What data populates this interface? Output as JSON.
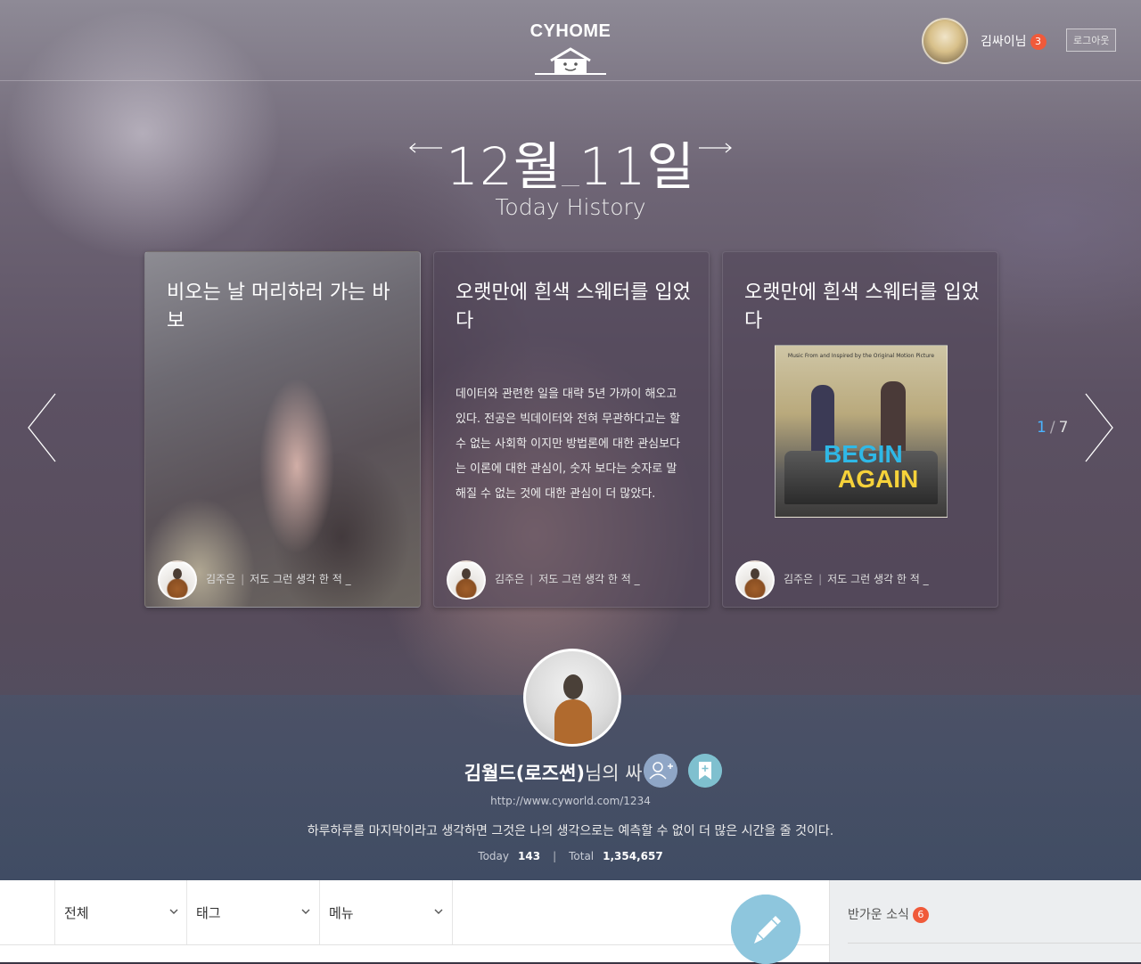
{
  "header": {
    "logo_text": "CYHOME",
    "user_name": "김싸이님",
    "user_badge": "3",
    "logout_label": "로그아웃"
  },
  "history": {
    "date": "12월 11일",
    "subtitle": "Today History",
    "pager_current": "1",
    "pager_separator": "/",
    "pager_total": "7"
  },
  "cards": [
    {
      "title": "비오는 날 머리하러 가는 바보",
      "body": "",
      "author": "김주은",
      "excerpt": "저도 그런 생각 한 적 _"
    },
    {
      "title": "오랫만에 흰색 스웨터를 입었다",
      "body": "데이터와 관련한 일을 대략 5년 가까이 해오고 있다. 전공은 빅데이터와 전혀 무관하다고는 할 수 없는 사회학 이지만 방법론에 대한 관심보다는 이론에 대한 관심이, 숫자 보다는 숫자로 말해질 수 없는 것에 대한 관심이 더 많았다.",
      "author": "김주은",
      "excerpt": "저도 그런 생각 한 적 _"
    },
    {
      "title": "오랫만에 흰색 스웨터를 입었다",
      "album_caption": "Music From and Inspired by the Original Motion Picture",
      "album_title_1": "BEGIN",
      "album_title_2": "AGAIN",
      "author": "김주은",
      "excerpt": "저도 그런 생각 한 적 _"
    }
  ],
  "profile": {
    "name": "김월드(로즈썬)",
    "name_suffix": "님의 싸이홈",
    "url": "http://www.cyworld.com/1234",
    "description": "하루하루를 마지막이라고 생각하면 그것은 나의 생각으로는 예측할 수 없이 더 많은 시간을 줄 것이다.",
    "today_label": "Today",
    "today_value": "143",
    "total_label": "Total",
    "total_value": "1,354,657"
  },
  "filters": {
    "all_label": "전체",
    "tag_label": "태그",
    "menu_label": "메뉴"
  },
  "news": {
    "label": "반가운 소식",
    "count": "6"
  },
  "colors": {
    "accent_blue": "#4ab3ff",
    "badge_red": "#f05a3a",
    "write_button": "#8ec6dd"
  }
}
